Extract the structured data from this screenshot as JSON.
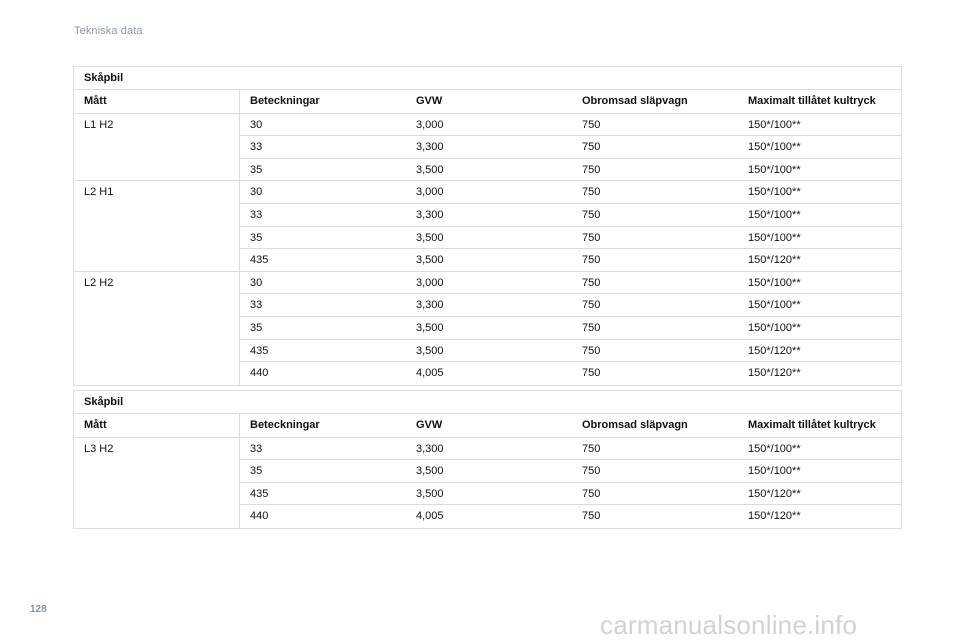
{
  "header": {
    "title": "Tekniska data"
  },
  "footer": {
    "page_number": "128",
    "watermark": "carmanualsonline.info"
  },
  "columns": [
    "Mått",
    "Beteckningar",
    "GVW",
    "Obromsad släpvagn",
    "Maximalt tillåtet kultryck"
  ],
  "table1": {
    "caption": "Skåpbil",
    "rows": [
      [
        "L1 H2",
        "30",
        "3,000",
        "750",
        "150*/100**"
      ],
      [
        "",
        "33",
        "3,300",
        "750",
        "150*/100**"
      ],
      [
        "",
        "35",
        "3,500",
        "750",
        "150*/100**"
      ],
      [
        "L2 H1",
        "30",
        "3,000",
        "750",
        "150*/100**"
      ],
      [
        "",
        "33",
        "3,300",
        "750",
        "150*/100**"
      ],
      [
        "",
        "35",
        "3,500",
        "750",
        "150*/100**"
      ],
      [
        "",
        "435",
        "3,500",
        "750",
        "150*/120**"
      ],
      [
        "L2 H2",
        "30",
        "3,000",
        "750",
        "150*/100**"
      ],
      [
        "",
        "33",
        "3,300",
        "750",
        "150*/100**"
      ],
      [
        "",
        "35",
        "3,500",
        "750",
        "150*/100**"
      ],
      [
        "",
        "435",
        "3,500",
        "750",
        "150*/120**"
      ],
      [
        "",
        "440",
        "4,005",
        "750",
        "150*/120**"
      ]
    ]
  },
  "table2": {
    "caption": "Skåpbil",
    "rows": [
      [
        "L3 H2",
        "33",
        "3,300",
        "750",
        "150*/100**"
      ],
      [
        "",
        "35",
        "3,500",
        "750",
        "150*/100**"
      ],
      [
        "",
        "435",
        "3,500",
        "750",
        "150*/120**"
      ],
      [
        "",
        "440",
        "4,005",
        "750",
        "150*/120**"
      ]
    ]
  }
}
